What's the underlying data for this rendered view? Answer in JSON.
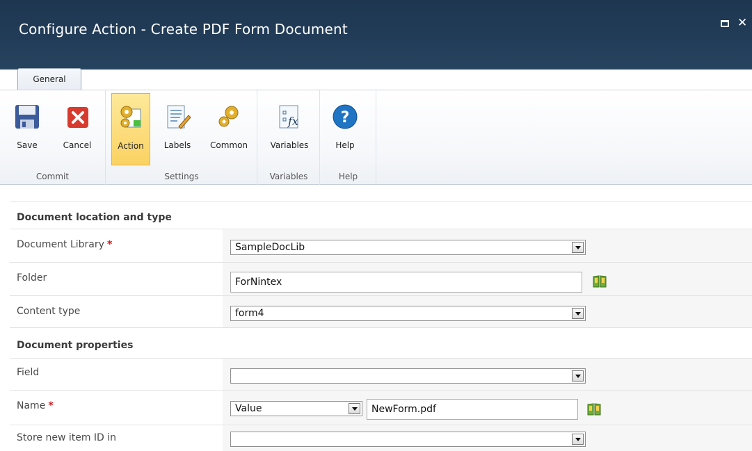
{
  "window": {
    "title": "Configure Action - Create PDF Form Document"
  },
  "tabs": [
    {
      "label": "General"
    }
  ],
  "ribbon": {
    "groups": [
      {
        "label": "Commit",
        "buttons": [
          {
            "label": "Save",
            "icon": "save-icon"
          },
          {
            "label": "Cancel",
            "icon": "cancel-icon"
          }
        ]
      },
      {
        "label": "Settings",
        "buttons": [
          {
            "label": "Action",
            "icon": "action-gears-icon",
            "active": true
          },
          {
            "label": "Labels",
            "icon": "labels-pencil-icon"
          },
          {
            "label": "Common",
            "icon": "common-gears-icon"
          }
        ]
      },
      {
        "label": "Variables",
        "buttons": [
          {
            "label": "Variables",
            "icon": "variables-fx-icon"
          }
        ]
      },
      {
        "label": "Help",
        "buttons": [
          {
            "label": "Help",
            "icon": "help-icon"
          }
        ]
      }
    ]
  },
  "form": {
    "location_section": "Document location and type",
    "document_library": {
      "label": "Document Library",
      "required": "*",
      "value": "SampleDocLib"
    },
    "folder": {
      "label": "Folder",
      "value": "ForNintex"
    },
    "content_type": {
      "label": "Content type",
      "value": "form4"
    },
    "properties_section": "Document properties",
    "field": {
      "label": "Field",
      "value": ""
    },
    "name": {
      "label": "Name",
      "required": "*",
      "source": "Value",
      "value": "NewForm.pdf"
    },
    "store_id": {
      "label": "Store new item ID in",
      "value": ""
    }
  },
  "colors": {
    "titlebar": "#223d59",
    "active_button": "#fbd262",
    "required": "#d2191c"
  }
}
